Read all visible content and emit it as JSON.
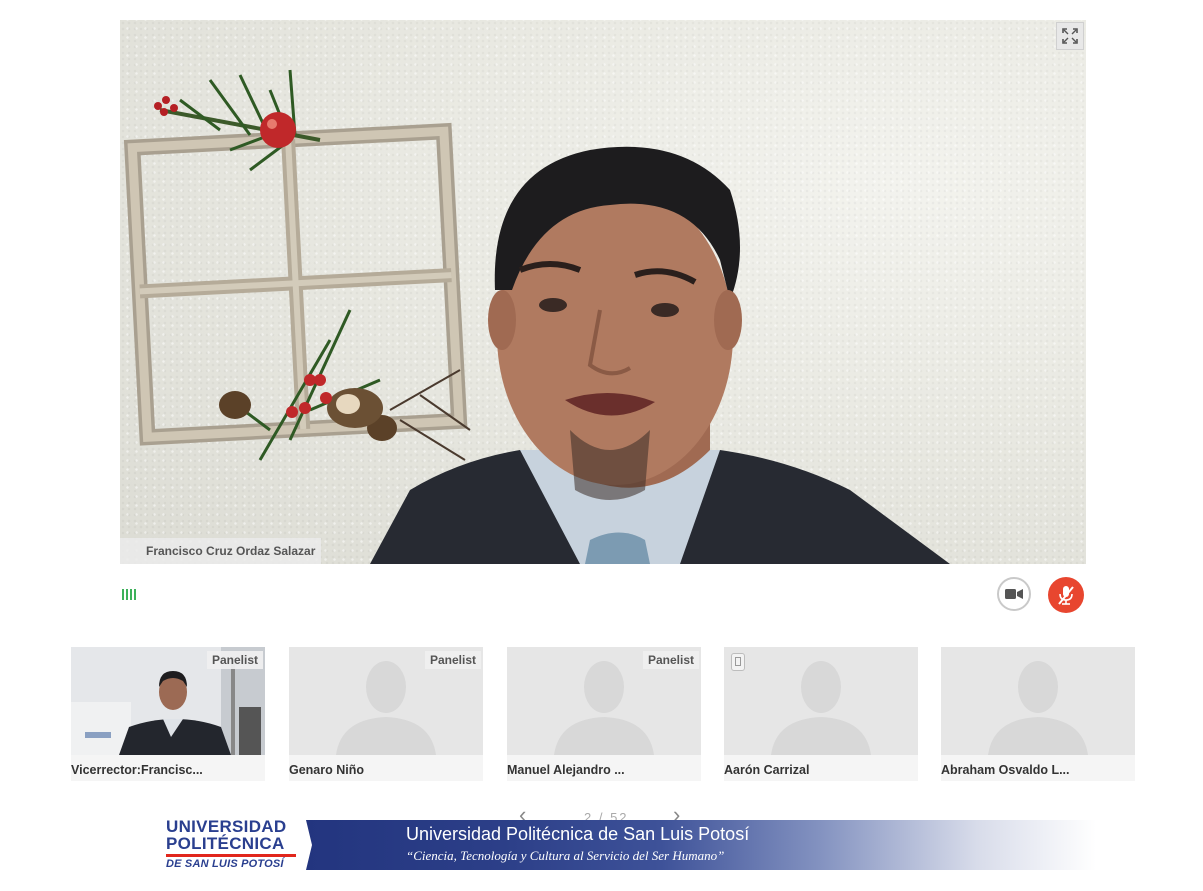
{
  "main_video": {
    "speaker_name": "Francisco Cruz Ordaz Salazar",
    "fullscreen_icon": "expand-icon"
  },
  "controls": {
    "signal_icon": "signal-strength-icon",
    "camera_icon": "video-camera-icon",
    "mic_icon": "microphone-muted-icon",
    "mic_color": "#e8462f",
    "signal_color": "#3db15a"
  },
  "participants": [
    {
      "name": "Vicerrector:Francisc...",
      "badge": "Panelist",
      "has_video": true
    },
    {
      "name": "Genaro Niño",
      "badge": "Panelist",
      "has_video": false
    },
    {
      "name": "Manuel Alejandro ...",
      "badge": "Panelist",
      "has_video": false
    },
    {
      "name": "Aarón Carrizal",
      "badge": "",
      "device_icon": "phone-icon",
      "has_video": false
    },
    {
      "name": "Abraham Osvaldo L...",
      "badge": "",
      "has_video": false
    }
  ],
  "pager": {
    "prev_icon": "chevron-left-icon",
    "next_icon": "chevron-right-icon",
    "text": "2 / 52"
  },
  "footer": {
    "logo_line1": "UNIVERSIDAD",
    "logo_line2": "POLITÉCNICA",
    "logo_line3": "DE SAN LUIS POTOSÍ",
    "title": "Universidad Politécnica de San Luis Potosí",
    "motto": "“Ciencia, Tecnología y Cultura al Servicio del Ser Humano”",
    "brand_color": "#2a3f8f",
    "accent_color": "#e1261c"
  }
}
